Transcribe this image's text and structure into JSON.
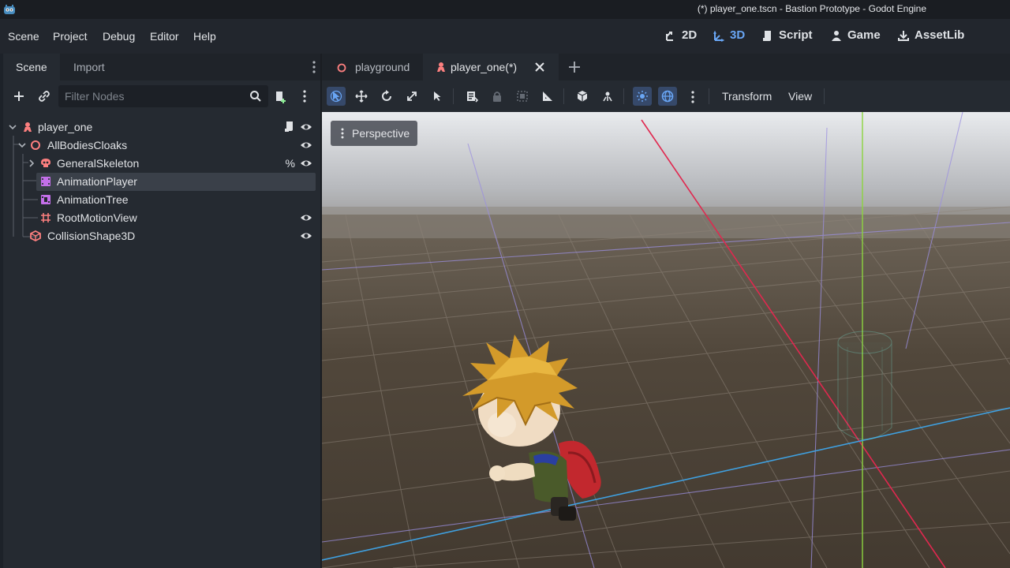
{
  "window": {
    "title": "(*) player_one.tscn - Bastion Prototype - Godot Engine"
  },
  "menu": {
    "items": [
      "Scene",
      "Project",
      "Debug",
      "Editor",
      "Help"
    ]
  },
  "workspaces": [
    {
      "label": "2D",
      "icon": "2d-icon"
    },
    {
      "label": "3D",
      "icon": "3d-icon",
      "active": true
    },
    {
      "label": "Script",
      "icon": "script-icon"
    },
    {
      "label": "Game",
      "icon": "game-icon"
    },
    {
      "label": "AssetLib",
      "icon": "assetlib-icon"
    }
  ],
  "left_dock": {
    "tabs": [
      "Scene",
      "Import"
    ],
    "filter_placeholder": "Filter Nodes"
  },
  "scene_tree": {
    "nodes": [
      {
        "name": "player_one",
        "icon": "character-body-icon"
      },
      {
        "name": "AllBodiesCloaks",
        "icon": "node3d-icon"
      },
      {
        "name": "GeneralSkeleton",
        "icon": "skeleton-icon",
        "extra": "%"
      },
      {
        "name": "AnimationPlayer",
        "icon": "animation-player-icon",
        "selected": true
      },
      {
        "name": "AnimationTree",
        "icon": "animation-tree-icon"
      },
      {
        "name": "RootMotionView",
        "icon": "root-motion-icon"
      },
      {
        "name": "CollisionShape3D",
        "icon": "collision-shape-icon"
      }
    ]
  },
  "editor_tabs": [
    {
      "label": "playground"
    },
    {
      "label": "player_one(*)",
      "active": true
    }
  ],
  "viewport_toolbar": {
    "transform_menu": "Transform",
    "view_menu": "View"
  },
  "viewport": {
    "view_label": "Perspective"
  },
  "colors": {
    "accent": "#69a6f5",
    "x_axis": "#e0284f",
    "y_axis": "#8cd43f",
    "z_axis": "#3fa0e0",
    "node_icon_red": "#fc7f7f",
    "node_icon_purple": "#c36fe9"
  }
}
